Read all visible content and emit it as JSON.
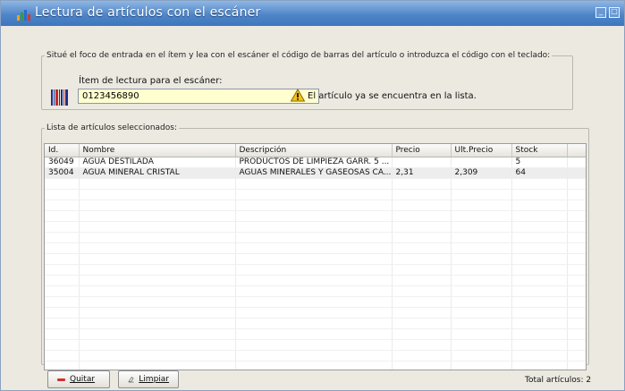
{
  "window": {
    "title": "Lectura de artículos con el escáner"
  },
  "instructions": {
    "text": "Situé el foco de entrada en el ítem y lea con el escáner el código de barras del artículo o introduzca el código con el teclado:",
    "field_label": "Ítem de lectura para el escáner:",
    "field_value": "0123456890",
    "warning": "El artículo ya se encuentra en la lista."
  },
  "list": {
    "legend": "Lista de artículos seleccionados:",
    "columns": [
      "Id.",
      "Nombre",
      "Descripción",
      "Precio",
      "Ult.Precio",
      "Stock"
    ],
    "rows": [
      {
        "id": "36049",
        "nombre": "AGUA DESTILADA",
        "descripcion": "PRODUCTOS DE LIMPIEZA GARR. 5 ...",
        "precio": "",
        "ult_precio": "",
        "stock": "5"
      },
      {
        "id": "35004",
        "nombre": "AGUA MINERAL CRISTAL",
        "descripcion": "AGUAS MINERALES Y GASEOSAS CA...",
        "precio": "2,31",
        "ult_precio": "2,309",
        "stock": "64"
      }
    ]
  },
  "buttons": {
    "quitar": "Quitar",
    "limpiar": "Limpiar"
  },
  "footer": {
    "total": "Total artículos: 2"
  },
  "icons": {
    "title": "app-icon",
    "barcode": "barcode-icon",
    "warning": "warning-icon",
    "quitar": "minus-icon",
    "limpiar": "eraser-icon"
  },
  "colors": {
    "titlebar": "#4f86c8",
    "input_bg": "#ffffd0",
    "minus": "#d23030",
    "warning": "#f2c21a"
  }
}
